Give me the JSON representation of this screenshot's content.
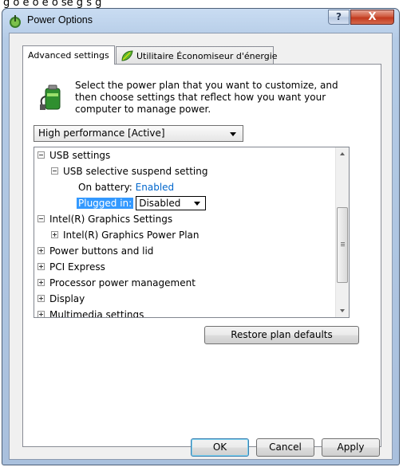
{
  "background_fragment": "g                                 o  e  o  e  o   se  g  s  g",
  "window": {
    "title": "Power Options",
    "help_label": "?",
    "close_label": "X"
  },
  "tabs": [
    {
      "label": "Advanced settings",
      "active": true
    },
    {
      "label": "Utilitaire Économiseur d'énergie",
      "active": false
    }
  ],
  "intro_text": "Select the power plan that you want to customize, and then choose settings that reflect how you want your computer to manage power.",
  "plan": {
    "selected": "High performance [Active]"
  },
  "tree": {
    "items": [
      {
        "label": "USB settings",
        "level": 0,
        "expander": "minus"
      },
      {
        "label": "USB selective suspend setting",
        "level": 1,
        "expander": "minus"
      },
      {
        "label": "On battery:",
        "value": "Enabled",
        "level": 2
      },
      {
        "label": "Plugged in:",
        "value": "Disabled",
        "level": 2,
        "selected": true
      },
      {
        "label": "Intel(R) Graphics Settings",
        "level": 0,
        "expander": "minus"
      },
      {
        "label": "Intel(R) Graphics Power Plan",
        "level": 1,
        "expander": "plus"
      },
      {
        "label": "Power buttons and lid",
        "level": 0,
        "expander": "plus"
      },
      {
        "label": "PCI Express",
        "level": 0,
        "expander": "plus"
      },
      {
        "label": "Processor power management",
        "level": 0,
        "expander": "plus"
      },
      {
        "label": "Display",
        "level": 0,
        "expander": "plus"
      },
      {
        "label": "Multimedia settings",
        "level": 0,
        "expander": "plus"
      }
    ]
  },
  "buttons": {
    "restore": "Restore plan defaults",
    "ok": "OK",
    "cancel": "Cancel",
    "apply": "Apply"
  },
  "colors": {
    "link": "#0066cc",
    "selection": "#3399ff",
    "close_button": "#c23a1f"
  }
}
